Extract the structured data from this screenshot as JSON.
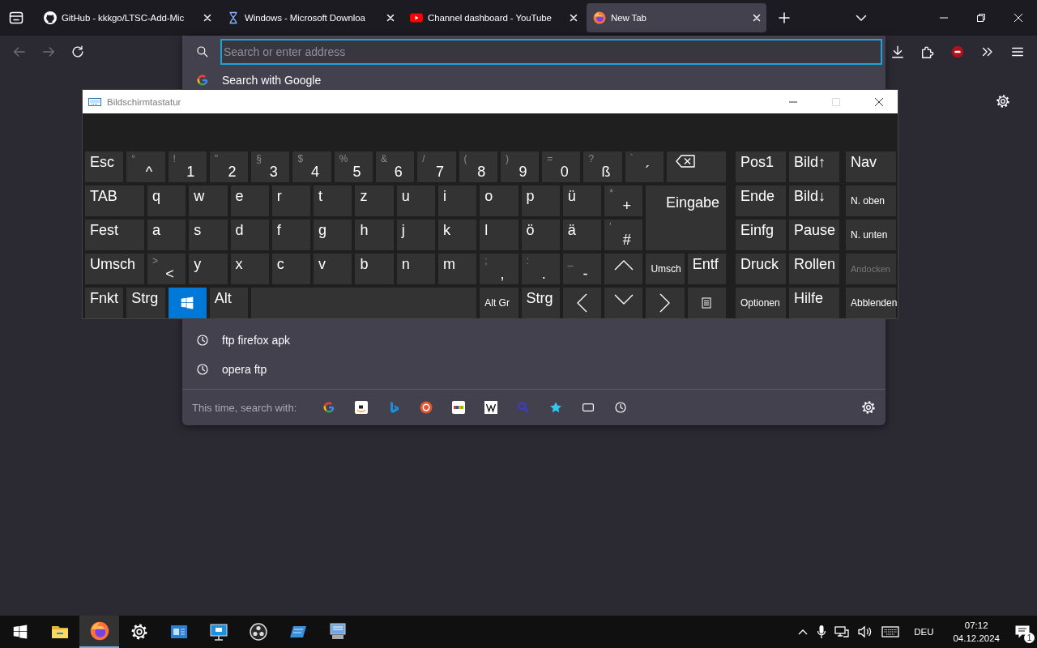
{
  "browser": {
    "tabs": [
      {
        "kind": "github",
        "title": "GitHub - kkkgo/LTSC-Add-Mic",
        "selected": false
      },
      {
        "kind": "hourglass",
        "title": "Windows - Microsoft Downloa",
        "selected": false
      },
      {
        "kind": "youtube",
        "title": "Channel dashboard - YouTube",
        "selected": false
      },
      {
        "kind": "firefox",
        "title": "New Tab",
        "selected": true
      }
    ],
    "address": {
      "placeholder": "Search or enter address"
    },
    "suggestions": [
      {
        "kind": "engine",
        "text": "Search with Google"
      },
      {
        "kind": "history",
        "text": "ftp firefox apk"
      },
      {
        "kind": "history",
        "text": "opera ftp"
      }
    ],
    "search_with": "This time, search with:"
  },
  "keyboard": {
    "title": "Bildschirmtastatur",
    "main_rows": [
      [
        {
          "kind": "key",
          "label": "Esc"
        },
        {
          "kind": "key",
          "label": "^",
          "shift": "°"
        },
        {
          "kind": "key",
          "label": "1",
          "shift": "!"
        },
        {
          "kind": "key",
          "label": "2",
          "shift": "\""
        },
        {
          "kind": "key",
          "label": "3",
          "shift": "§"
        },
        {
          "kind": "key",
          "label": "4",
          "shift": "$"
        },
        {
          "kind": "key",
          "label": "5",
          "shift": "%"
        },
        {
          "kind": "key",
          "label": "6",
          "shift": "&"
        },
        {
          "kind": "key",
          "label": "7",
          "shift": "/"
        },
        {
          "kind": "key",
          "label": "8",
          "shift": "("
        },
        {
          "kind": "key",
          "label": "9",
          "shift": ")"
        },
        {
          "kind": "key",
          "label": "0",
          "shift": "="
        },
        {
          "kind": "key",
          "label": "ß",
          "shift": "?"
        },
        {
          "kind": "key",
          "label": "´",
          "shift": "`"
        },
        {
          "kind": "backspace"
        }
      ],
      [
        {
          "kind": "key",
          "label": "TAB"
        },
        {
          "kind": "key",
          "label": "q"
        },
        {
          "kind": "key",
          "label": "w"
        },
        {
          "kind": "key",
          "label": "e"
        },
        {
          "kind": "key",
          "label": "r"
        },
        {
          "kind": "key",
          "label": "t"
        },
        {
          "kind": "key",
          "label": "z"
        },
        {
          "kind": "key",
          "label": "u"
        },
        {
          "kind": "key",
          "label": "i"
        },
        {
          "kind": "key",
          "label": "o"
        },
        {
          "kind": "key",
          "label": "p"
        },
        {
          "kind": "key",
          "label": "ü"
        },
        {
          "kind": "key",
          "label": "+",
          "shift": "*"
        },
        {
          "kind": "enter",
          "label": "Eingabe"
        }
      ],
      [
        {
          "kind": "key",
          "label": "Fest"
        },
        {
          "kind": "key",
          "label": "a"
        },
        {
          "kind": "key",
          "label": "s"
        },
        {
          "kind": "key",
          "label": "d"
        },
        {
          "kind": "key",
          "label": "f"
        },
        {
          "kind": "key",
          "label": "g"
        },
        {
          "kind": "key",
          "label": "h"
        },
        {
          "kind": "key",
          "label": "j"
        },
        {
          "kind": "key",
          "label": "k"
        },
        {
          "kind": "key",
          "label": "l"
        },
        {
          "kind": "key",
          "label": "ö"
        },
        {
          "kind": "key",
          "label": "ä"
        },
        {
          "kind": "key",
          "label": "#",
          "shift": "'"
        }
      ],
      [
        {
          "kind": "key",
          "label": "Umsch"
        },
        {
          "kind": "key",
          "label": "<",
          "shift": ">"
        },
        {
          "kind": "key",
          "label": "y"
        },
        {
          "kind": "key",
          "label": "x"
        },
        {
          "kind": "key",
          "label": "c"
        },
        {
          "kind": "key",
          "label": "v"
        },
        {
          "kind": "key",
          "label": "b"
        },
        {
          "kind": "key",
          "label": "n"
        },
        {
          "kind": "key",
          "label": "m"
        },
        {
          "kind": "key",
          "label": ",",
          "shift": ";"
        },
        {
          "kind": "key",
          "label": ".",
          "shift": ":"
        },
        {
          "kind": "key",
          "label": "-",
          "shift": "_"
        },
        {
          "kind": "up"
        },
        {
          "kind": "small",
          "label": "Umsch"
        },
        {
          "kind": "key",
          "label": "Entf"
        }
      ],
      [
        {
          "kind": "key",
          "label": "Fnkt"
        },
        {
          "kind": "key",
          "label": "Strg"
        },
        {
          "kind": "win"
        },
        {
          "kind": "key",
          "label": "Alt"
        },
        {
          "kind": "space"
        },
        {
          "kind": "small",
          "label": "Alt Gr"
        },
        {
          "kind": "key",
          "label": "Strg"
        },
        {
          "kind": "left"
        },
        {
          "kind": "down"
        },
        {
          "kind": "right"
        },
        {
          "kind": "menu"
        }
      ]
    ],
    "side_rows": [
      [
        {
          "kind": "key",
          "label": "Pos1"
        },
        {
          "kind": "key",
          "label": "Bild↑"
        },
        {
          "kind": "key",
          "label": "Nav"
        }
      ],
      [
        {
          "kind": "key",
          "label": "Ende"
        },
        {
          "kind": "key",
          "label": "Bild↓"
        },
        {
          "kind": "small",
          "label": "N. oben"
        }
      ],
      [
        {
          "kind": "key",
          "label": "Einfg"
        },
        {
          "kind": "key",
          "label": "Pause"
        },
        {
          "kind": "small",
          "label": "N. unten"
        }
      ],
      [
        {
          "kind": "key",
          "label": "Druck"
        },
        {
          "kind": "key",
          "label": "Rollen"
        },
        {
          "kind": "muted",
          "label": "Andocken"
        }
      ],
      [
        {
          "kind": "small",
          "label": "Optionen"
        },
        {
          "kind": "key",
          "label": "Hilfe"
        },
        {
          "kind": "small",
          "label": "Abblenden"
        }
      ]
    ]
  },
  "taskbar": {
    "apps": [
      {
        "kind": "explorer",
        "selected": false
      },
      {
        "kind": "firefox",
        "selected": true
      },
      {
        "kind": "settings",
        "selected": false
      },
      {
        "kind": "panel",
        "selected": false
      },
      {
        "kind": "remote",
        "selected": false
      },
      {
        "kind": "obs",
        "selected": false
      },
      {
        "kind": "tilted",
        "selected": false
      },
      {
        "kind": "computer",
        "selected": false
      }
    ],
    "language": "DEU",
    "time": "07:12",
    "date": "04.12.2024",
    "notifications": "1"
  }
}
